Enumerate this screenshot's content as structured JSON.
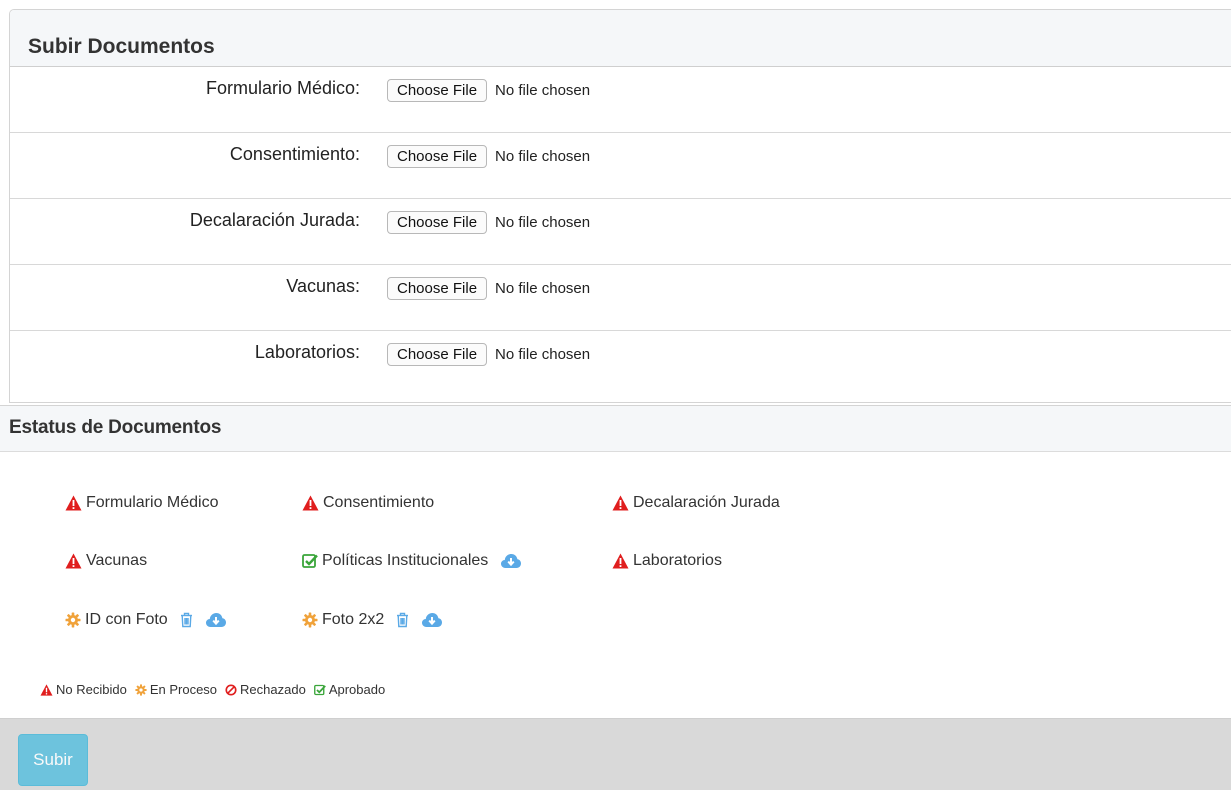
{
  "upload": {
    "title": "Subir Documentos",
    "button_label": "Choose File",
    "no_file_text": "No file chosen",
    "rows": [
      {
        "label": "Formulario Médico:"
      },
      {
        "label": "Consentimiento:"
      },
      {
        "label": "Decalaración Jurada:"
      },
      {
        "label": "Vacunas:"
      },
      {
        "label": "Laboratorios:"
      }
    ]
  },
  "status": {
    "title": "Estatus de Documentos",
    "items": [
      {
        "label": "Formulario Médico",
        "state": "no-recibido"
      },
      {
        "label": "Consentimiento",
        "state": "no-recibido"
      },
      {
        "label": "Decalaración Jurada",
        "state": "no-recibido"
      },
      {
        "label": "Vacunas",
        "state": "no-recibido"
      },
      {
        "label": "Políticas Institucionales",
        "state": "aprobado"
      },
      {
        "label": "Laboratorios",
        "state": "no-recibido"
      },
      {
        "label": "ID con Foto",
        "state": "en-proceso"
      },
      {
        "label": "Foto 2x2",
        "state": "en-proceso"
      }
    ],
    "legend": [
      {
        "label": "No Recibido"
      },
      {
        "label": "En Proceso"
      },
      {
        "label": "Rechazado"
      },
      {
        "label": "Aprobado"
      }
    ]
  },
  "colors": {
    "no_recibido": "#e01e1e",
    "en_proceso": "#f0a23a",
    "rechazado": "#e01e1e",
    "aprobado": "#3aa53a",
    "action": "#5aa9e6",
    "submit": "#5bc0de"
  },
  "icons": {
    "no_recibido": "warning-triangle-icon",
    "en_proceso": "gear-icon",
    "rechazado": "ban-icon",
    "aprobado": "check-square-icon",
    "delete": "trash-icon",
    "download": "cloud-download-icon"
  },
  "footer": {
    "submit_label": "Subir"
  }
}
